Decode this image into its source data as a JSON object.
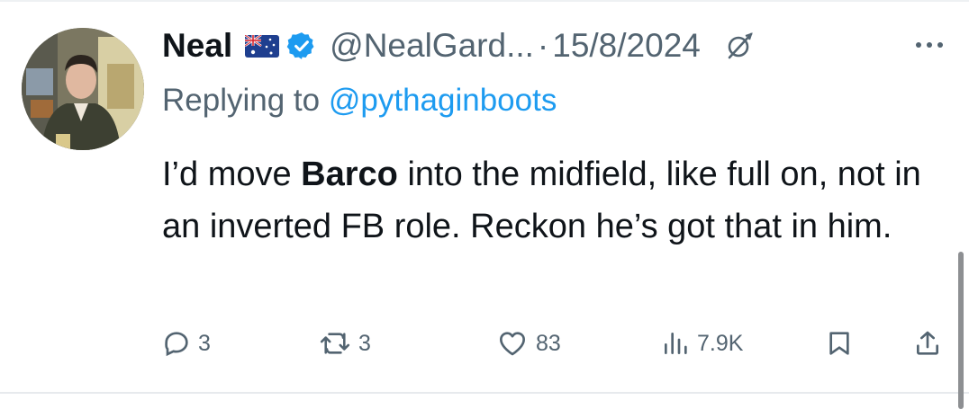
{
  "tweet": {
    "author": {
      "name": "Neal",
      "handle": "@NealGard...",
      "flag_icon": "australia-flag-icon",
      "verified_icon": "verified-badge-icon"
    },
    "separator": "·",
    "date": "15/8/2024",
    "replying_to_label": "Replying to",
    "replying_to_handle": "@pythaginboots",
    "text": {
      "part1": "I’d move ",
      "bold": "Barco",
      "part2": " into the midfield, like full on, not in an inverted FB role. Reckon he’s got that in him."
    },
    "stats": {
      "replies": "3",
      "retweets": "3",
      "likes": "83",
      "views": "7.9K"
    }
  },
  "colors": {
    "text_primary": "#0f1419",
    "text_secondary": "#536471",
    "link": "#1d9bf0",
    "verified": "#1d9bf0"
  }
}
